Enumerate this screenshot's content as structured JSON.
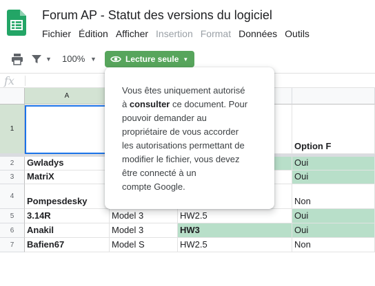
{
  "header": {
    "title": "Forum AP - Statut des versions du logiciel",
    "logo_icon": "google-sheets-logo",
    "brand_color": "#23a566"
  },
  "menu": [
    {
      "label": "Fichier",
      "enabled": true
    },
    {
      "label": "Édition",
      "enabled": true
    },
    {
      "label": "Afficher",
      "enabled": true
    },
    {
      "label": "Insertion",
      "enabled": false
    },
    {
      "label": "Format",
      "enabled": false
    },
    {
      "label": "Données",
      "enabled": true
    },
    {
      "label": "Outils",
      "enabled": true
    }
  ],
  "toolbar": {
    "print_icon": "print-icon",
    "filter_icon": "filter-icon",
    "zoom": "100%",
    "readonly_label": "Lecture seule",
    "readonly_color": "#57a55c"
  },
  "formula_bar": {
    "fx": "fx"
  },
  "grid": {
    "col_a_header": "A",
    "rows": [
      {
        "num": "1",
        "a": "",
        "b": "",
        "c": "",
        "d": "Option F"
      },
      {
        "num": "2",
        "a": "Gwladys",
        "b": "",
        "c": "",
        "d": "Oui"
      },
      {
        "num": "3",
        "a": "MatriX",
        "b": "",
        "c": "",
        "d": "Oui"
      },
      {
        "num": "4",
        "a": "Pompesdesky",
        "b": "",
        "c": "",
        "d": "Non"
      },
      {
        "num": "5",
        "a": "3.14R",
        "b": "Model 3",
        "c": "HW2.5",
        "d": "Oui"
      },
      {
        "num": "6",
        "a": "Anakil",
        "b": "Model 3",
        "c": "HW3",
        "d": "Oui"
      },
      {
        "num": "7",
        "a": "Bafien67",
        "b": "Model S",
        "c": "HW2.5",
        "d": "Non"
      }
    ],
    "highlight_color": "#b8dfc9"
  },
  "popup": {
    "line1": "Vous êtes uniquement autorisé",
    "line2_pre": "à ",
    "line2_bold": "consulter",
    "line2_post": " ce document. Pour",
    "line3": "pouvoir demander au",
    "line4": "propriétaire de vous accorder",
    "line5": "les autorisations permettant de",
    "line6": "modifier le fichier, vous devez",
    "line7": "être connecté à un",
    "line8": "compte Google."
  }
}
